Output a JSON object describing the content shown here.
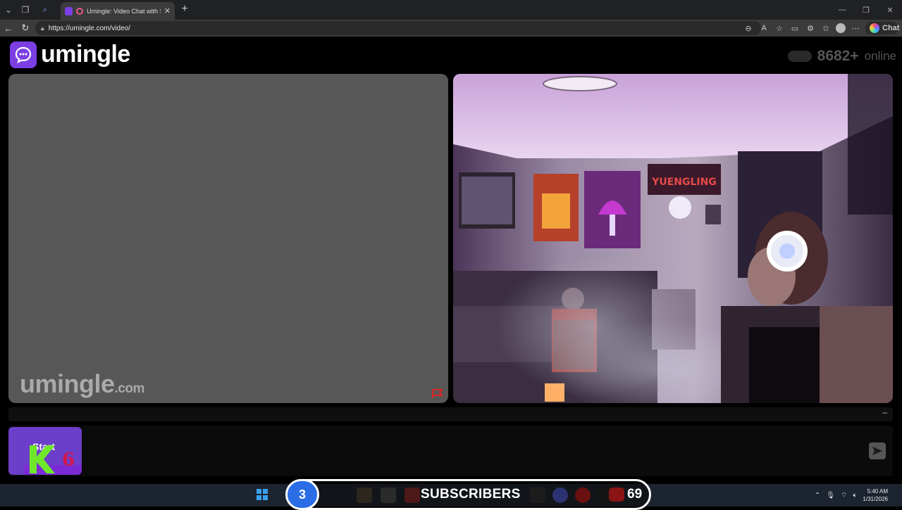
{
  "browser": {
    "tab_title": "Umingle: Video Chat with Stra",
    "url": "https://umingle.com/video/",
    "chat_label": "Chat"
  },
  "site": {
    "logo_text": "umingle",
    "online_count": "8682+",
    "online_label": "online",
    "watermark_main": "umingle",
    "watermark_suffix": ".com",
    "poster_text": "YUENGLING"
  },
  "controls": {
    "start_label": "Start",
    "minimize": "–"
  },
  "overlay": {
    "left_number": "3",
    "subscribers_label": "SUBSCRIBERS",
    "count": "69"
  },
  "taskbar": {
    "time": "5:40 AM",
    "date": "1/31/2026"
  },
  "colors": {
    "brand_purple": "#7b3fe4",
    "overlay_blue": "#2b6de6"
  }
}
